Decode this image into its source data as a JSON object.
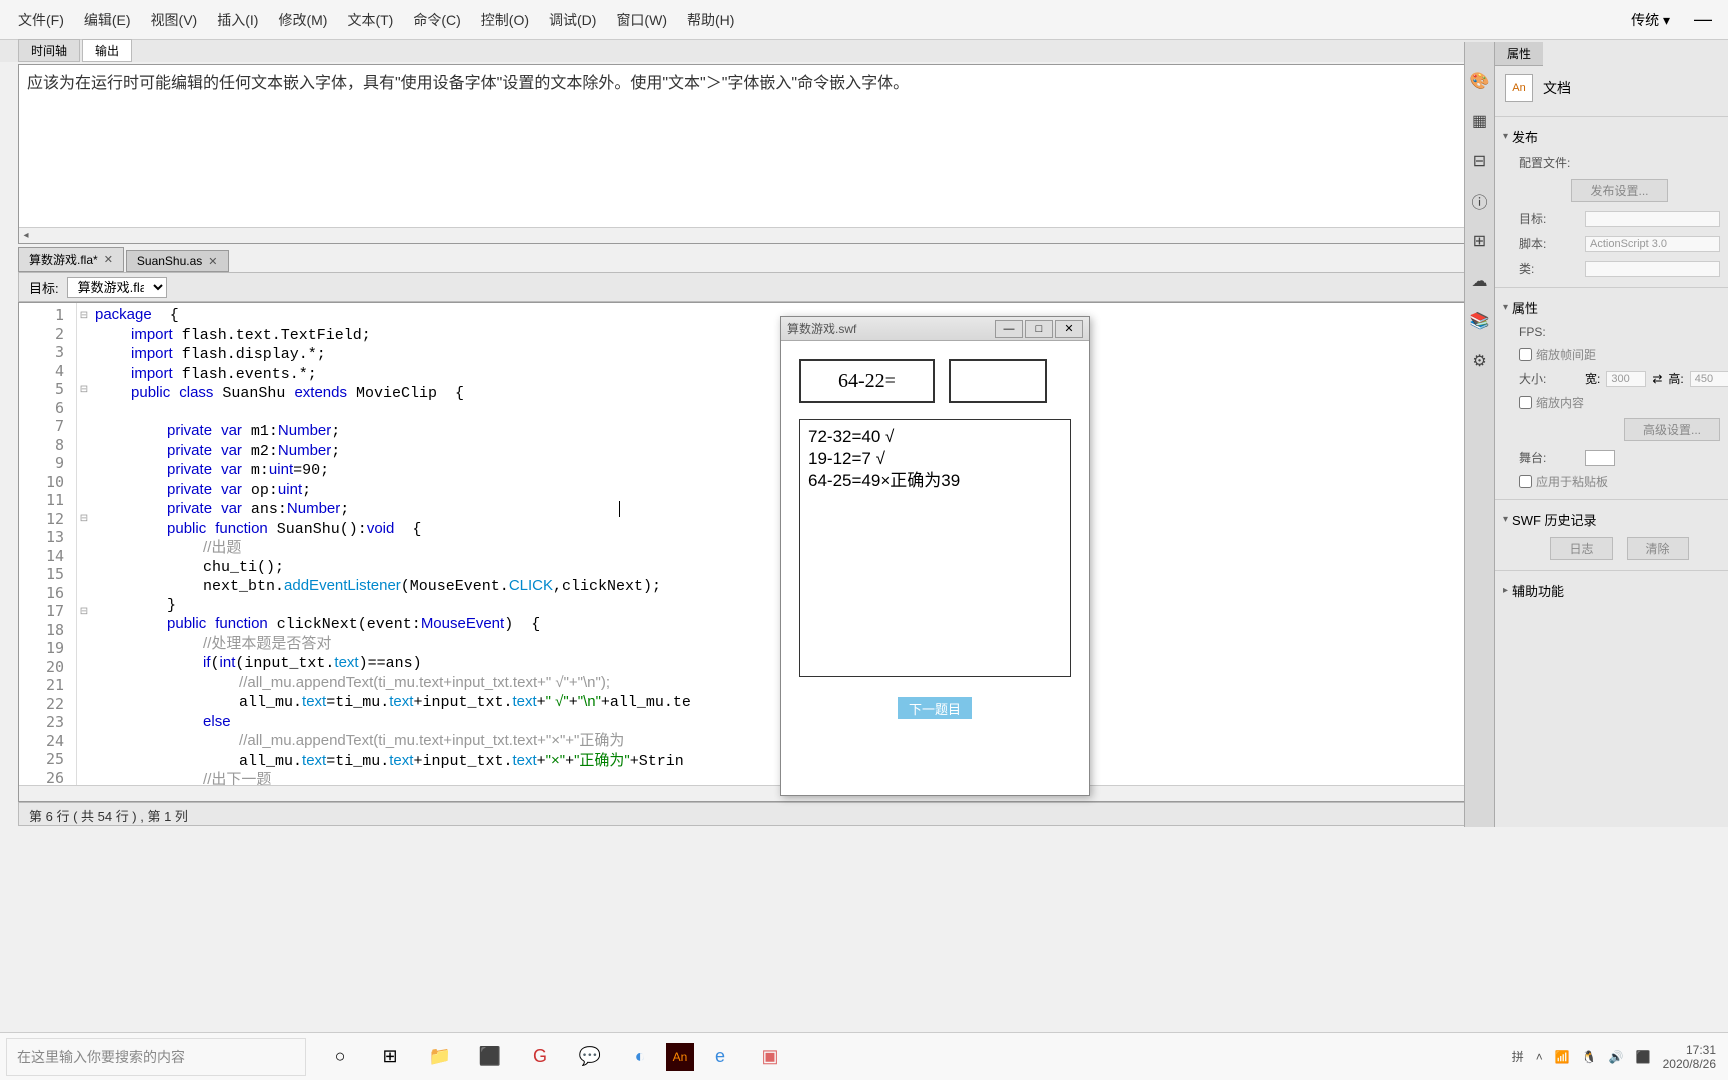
{
  "menubar": {
    "items": [
      "文件(F)",
      "编辑(E)",
      "视图(V)",
      "插入(I)",
      "修改(M)",
      "文本(T)",
      "命令(C)",
      "控制(O)",
      "调试(D)",
      "窗口(W)",
      "帮助(H)"
    ],
    "layout_dropdown": "传统"
  },
  "sub_tabs": {
    "timeline": "时间轴",
    "output": "输出"
  },
  "output": {
    "text": "应该为在运行时可能编辑的任何文本嵌入字体，具有\"使用设备字体\"设置的文本除外。使用\"文本\"＞\"字体嵌入\"命令嵌入字体。"
  },
  "file_tabs": [
    {
      "label": "算数游戏.fla*",
      "active": false
    },
    {
      "label": "SuanShu.as",
      "active": true
    }
  ],
  "target": {
    "label": "目标:",
    "value": "算数游戏.fla"
  },
  "code": {
    "lines": [
      1,
      2,
      3,
      4,
      5,
      6,
      7,
      8,
      9,
      10,
      11,
      12,
      13,
      14,
      15,
      16,
      17,
      18,
      19,
      20,
      21,
      22,
      23,
      24,
      25,
      26
    ]
  },
  "status": "第 6 行 ( 共 54 行 ) , 第 1 列",
  "swf": {
    "title": "算数游戏.swf",
    "question": "64-22=",
    "answer": "",
    "output_lines": [
      "72-32=40 √",
      "19-12=7 √",
      "64-25=49×正确为39"
    ],
    "next_btn": "下一题目"
  },
  "props": {
    "tab": "属性",
    "doc_label": "文档",
    "publish": {
      "title": "发布",
      "config_label": "配置文件:",
      "settings_btn": "发布设置...",
      "target_label": "目标:",
      "script_label": "脚本:",
      "script_value": "ActionScript 3.0",
      "class_label": "类:"
    },
    "properties": {
      "title": "属性",
      "fps_label": "FPS:",
      "fps_check": "缩放帧间距",
      "size_label": "大小:",
      "width_label": "宽:",
      "width_value": "300",
      "height_label": "高:",
      "height_value": "450",
      "scale_check": "缩放内容",
      "advanced_btn": "高级设置...",
      "stage_label": "舞台:",
      "paste_check": "应用于粘贴板"
    },
    "swf_history": {
      "title": "SWF 历史记录",
      "log_btn": "日志",
      "clear_btn": "清除"
    },
    "accessibility": {
      "title": "辅助功能"
    }
  },
  "taskbar": {
    "search_placeholder": "在这里输入你要搜索的内容",
    "ime": "拼",
    "time": "17:31",
    "date": "2020/8/26"
  }
}
